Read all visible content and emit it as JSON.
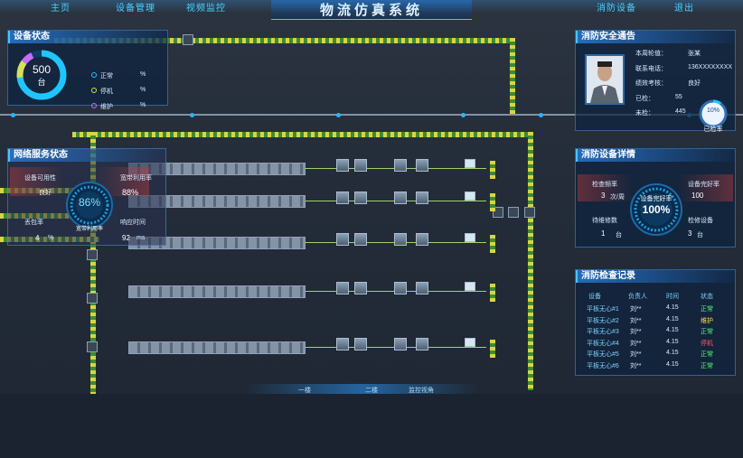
{
  "nav": {
    "title": "物流仿真系统",
    "items": [
      "主页",
      "设备管理",
      "视频监控",
      "消防设备",
      "退出"
    ]
  },
  "device_status": {
    "title": "设备状态",
    "total_value": "500",
    "total_unit": "台",
    "legend": [
      {
        "label": "正常",
        "value": "%",
        "color": "#26c4ff"
      },
      {
        "label": "停机",
        "value": "%",
        "color": "#d6e05a"
      },
      {
        "label": "维护",
        "value": "%",
        "color": "#c36cff"
      }
    ]
  },
  "network_status": {
    "title": "网络服务状态",
    "availability_label": "设备可用性",
    "availability_value": "良好",
    "bandwidth_label": "宽带利用率",
    "bandwidth_value": "88%",
    "loss_label": "丢包率",
    "loss_value": "4",
    "loss_unit": "%",
    "response_label": "响应时间",
    "response_value": "92",
    "response_unit": "ms",
    "gauge_value": "86%",
    "gauge_label": "宽带利用率"
  },
  "fire_notice": {
    "title": "消防安全通告",
    "rows": [
      {
        "label": "本周轮值：",
        "value": "张某"
      },
      {
        "label": "联系电话：",
        "value": "136XXXXXXXX"
      },
      {
        "label": "绩效考核：",
        "value": "良好"
      },
      {
        "label": "已检：",
        "value": "55"
      },
      {
        "label": "未检：",
        "value": "445"
      }
    ],
    "ring_value": "10%",
    "ring_label": "已检率",
    "checked_fraction": 0.1
  },
  "fire_equipment": {
    "title": "消防设备详情",
    "inspection_label": "检查频率",
    "inspection_value": "3",
    "inspection_unit": "次/周",
    "usage_label": "设备完好率",
    "usage_value": "100",
    "pending_label": "待维修数",
    "pending_value": "1",
    "pending_unit": "台",
    "repairing_label": "检修设备",
    "repairing_value": "3",
    "repairing_unit": "台",
    "gauge_label": "设备完好率",
    "gauge_value": "100%"
  },
  "inspection_records": {
    "title": "消防检查记录",
    "headers": [
      "设备",
      "负责人",
      "时间",
      "状态"
    ],
    "rows": [
      {
        "device": "平板无心#1",
        "person": "刘**",
        "time": "4.15",
        "status": "正常",
        "level": "ok"
      },
      {
        "device": "平板无心#2",
        "person": "刘**",
        "time": "4.15",
        "status": "维护",
        "level": "warn"
      },
      {
        "device": "平板无心#3",
        "person": "刘**",
        "time": "4.15",
        "status": "正常",
        "level": "ok"
      },
      {
        "device": "平板无心#4",
        "person": "刘**",
        "time": "4.15",
        "status": "停机",
        "level": "bad"
      },
      {
        "device": "平板无心#5",
        "person": "刘**",
        "time": "4.15",
        "status": "正常",
        "level": "ok"
      },
      {
        "device": "平板无心#6",
        "person": "刘**",
        "time": "4.15",
        "status": "正常",
        "level": "ok"
      }
    ]
  },
  "bottom_tabs": [
    "一楼",
    "二楼",
    "监控视角"
  ],
  "colors": {
    "accent": "#46c6ff",
    "ok": "#4cff7a",
    "warn": "#ffe14a",
    "bad": "#ff5a7a"
  }
}
